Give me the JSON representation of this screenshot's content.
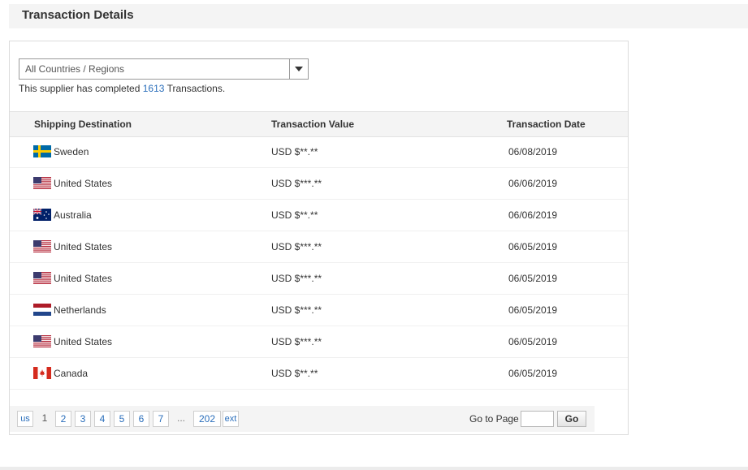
{
  "page": {
    "title": "Transaction Details"
  },
  "filter": {
    "selected": "All Countries / Regions"
  },
  "summary": {
    "prefix": "This supplier has completed ",
    "count": "1613",
    "suffix": " Transactions."
  },
  "table": {
    "headers": {
      "destination": "Shipping Destination",
      "value": "Transaction Value",
      "date": "Transaction Date"
    },
    "rows": [
      {
        "flag": "sweden-flag-icon",
        "country": "Sweden",
        "value": "USD $**.**",
        "date": "06/08/2019"
      },
      {
        "flag": "us-flag-icon",
        "country": "United States",
        "value": "USD $***.**",
        "date": "06/06/2019"
      },
      {
        "flag": "australia-flag-icon",
        "country": "Australia",
        "value": "USD $**.**",
        "date": "06/06/2019"
      },
      {
        "flag": "us-flag-icon",
        "country": "United States",
        "value": "USD $***.**",
        "date": "06/05/2019"
      },
      {
        "flag": "us-flag-icon",
        "country": "United States",
        "value": "USD $***.**",
        "date": "06/05/2019"
      },
      {
        "flag": "netherlands-flag-icon",
        "country": "Netherlands",
        "value": "USD $***.**",
        "date": "06/05/2019"
      },
      {
        "flag": "us-flag-icon",
        "country": "United States",
        "value": "USD $***.**",
        "date": "06/05/2019"
      },
      {
        "flag": "canada-flag-icon",
        "country": "Canada",
        "value": "USD $**.**",
        "date": "06/05/2019"
      }
    ]
  },
  "pagination": {
    "prev": "us",
    "current": "1",
    "pages": [
      "2",
      "3",
      "4",
      "5",
      "6",
      "7"
    ],
    "ellipsis": "...",
    "last": "202",
    "next": "ext",
    "goto_label": "Go to Page",
    "goto_value": "",
    "go_button": "Go"
  },
  "colors": {
    "accent": "#2a6ebb",
    "header_bg": "#f4f4f4"
  }
}
